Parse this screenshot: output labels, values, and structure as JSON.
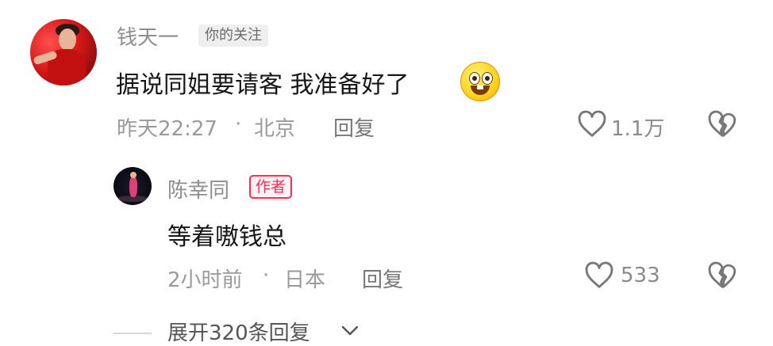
{
  "comment": {
    "username": "钱天一",
    "follow_tag": "你的关注",
    "text": "据说同姐要请客 我准备好了",
    "emoji_icon": "grinning-face-emoji",
    "time": "昨天22:27",
    "separator": "·",
    "location": "北京",
    "reply_label": "回复",
    "like_count": "1.1万"
  },
  "reply": {
    "username": "陈幸同",
    "author_tag": "作者",
    "text": "等着嗷钱总",
    "time": "2小时前",
    "separator": "·",
    "location": "日本",
    "reply_label": "回复",
    "like_count": "533"
  },
  "expand": {
    "label": "展开320条回复",
    "icon": "chevron-down-icon"
  },
  "colors": {
    "author_tag": "#fe2c55",
    "username": "#8d8d8d",
    "content": "#161616",
    "meta": "#9a9a9a"
  }
}
